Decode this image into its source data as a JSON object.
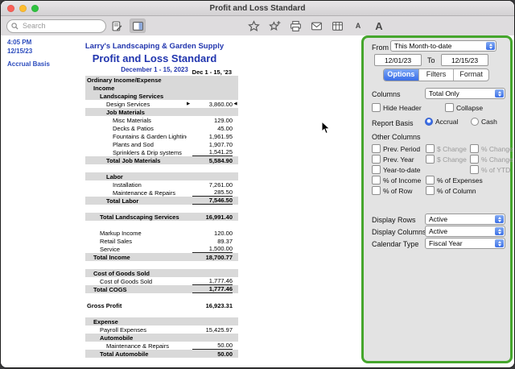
{
  "window": {
    "title": "Profit and Loss Standard"
  },
  "toolbar": {
    "search_placeholder": "Search",
    "font_small_label": "A",
    "font_large_label": "A"
  },
  "meta": {
    "time": "4:05 PM",
    "date": "12/15/23",
    "basis": "Accrual Basis"
  },
  "report": {
    "company": "Larry's Landscaping & Garden Supply",
    "title": "Profit and Loss Standard",
    "period": "December 1 - 15, 2023",
    "column_header": "Dec 1 - 15, '23",
    "rows": [
      {
        "label": "Ordinary Income/Expense",
        "value": "",
        "indent": 0,
        "band": true,
        "bold": true
      },
      {
        "label": "Income",
        "value": "",
        "indent": 1,
        "band": true,
        "bold": true
      },
      {
        "label": "Landscaping Services",
        "value": "",
        "indent": 2,
        "band": true,
        "bold": true
      },
      {
        "label": "Design Services",
        "value": "3,860.00",
        "indent": 3,
        "marker_pre": "▶",
        "marker_post": "◀"
      },
      {
        "label": "Job Materials",
        "value": "",
        "indent": 3,
        "band": true,
        "bold": true
      },
      {
        "label": "Misc Materials",
        "value": "129.00",
        "indent": 4
      },
      {
        "label": "Decks & Patios",
        "value": "45.00",
        "indent": 4
      },
      {
        "label": "Fountains & Garden Lighting",
        "value": "1,961.95",
        "indent": 4
      },
      {
        "label": "Plants and Sod",
        "value": "1,907.70",
        "indent": 4
      },
      {
        "label": "Sprinklers & Drip systems",
        "value": "1,541.25",
        "indent": 4,
        "underline": true
      },
      {
        "label": "Total Job Materials",
        "value": "5,584.90",
        "indent": 3,
        "band": true,
        "bold": true
      },
      {
        "spacer": true
      },
      {
        "label": "Labor",
        "value": "",
        "indent": 3,
        "band": true,
        "bold": true
      },
      {
        "label": "Installation",
        "value": "7,261.00",
        "indent": 4
      },
      {
        "label": "Maintenance & Repairs",
        "value": "285.50",
        "indent": 4,
        "underline": true
      },
      {
        "label": "Total Labor",
        "value": "7,546.50",
        "indent": 3,
        "band": true,
        "bold": true,
        "underline": true
      },
      {
        "spacer": true
      },
      {
        "label": "Total Landscaping Services",
        "value": "16,991.40",
        "indent": 2,
        "band": true,
        "bold": true
      },
      {
        "spacer": true
      },
      {
        "label": "Markup Income",
        "value": "120.00",
        "indent": 2
      },
      {
        "label": "Retail Sales",
        "value": "89.37",
        "indent": 2
      },
      {
        "label": "Service",
        "value": "1,500.00",
        "indent": 2,
        "underline": true
      },
      {
        "label": "Total Income",
        "value": "18,700.77",
        "indent": 1,
        "band": true,
        "bold": true
      },
      {
        "spacer": true
      },
      {
        "label": "Cost of Goods Sold",
        "value": "",
        "indent": 1,
        "band": true,
        "bold": true
      },
      {
        "label": "Cost of Goods Sold",
        "value": "1,777.46",
        "indent": 2,
        "underline": true
      },
      {
        "label": "Total COGS",
        "value": "1,777.46",
        "indent": 1,
        "band": true,
        "bold": true,
        "underline": true
      },
      {
        "spacer": true
      },
      {
        "label": "Gross Profit",
        "value": "16,923.31",
        "indent": 0,
        "bold": true
      },
      {
        "spacer": true
      },
      {
        "label": "Expense",
        "value": "",
        "indent": 1,
        "band": true,
        "bold": true
      },
      {
        "label": "Payroll Expenses",
        "value": "15,425.97",
        "indent": 2
      },
      {
        "label": "Automobile",
        "value": "",
        "indent": 2,
        "band": true,
        "bold": true
      },
      {
        "label": "Maintenance & Repairs",
        "value": "50.00",
        "indent": 3,
        "underline": true
      },
      {
        "label": "Total Automobile",
        "value": "50.00",
        "indent": 2,
        "band": true,
        "bold": true
      }
    ]
  },
  "panel": {
    "from": {
      "label": "From",
      "value": "This Month-to-date"
    },
    "date_range": {
      "from": "12/01/23",
      "to_label": "To",
      "to": "12/15/23"
    },
    "tabs": [
      {
        "label": "Options",
        "selected": true
      },
      {
        "label": "Filters",
        "selected": false
      },
      {
        "label": "Format",
        "selected": false
      }
    ],
    "columns": {
      "label": "Columns",
      "value": "Total Only"
    },
    "checks_top": [
      {
        "label": "Hide Header",
        "checked": false
      },
      {
        "label": "Collapse",
        "checked": false
      }
    ],
    "report_basis": {
      "label": "Report Basis",
      "options": [
        {
          "label": "Accrual",
          "selected": true
        },
        {
          "label": "Cash",
          "selected": false
        }
      ]
    },
    "other_columns_label": "Other Columns",
    "grid": [
      [
        {
          "label": "Prev. Period"
        },
        {
          "label": "$ Change",
          "disabled": true
        },
        {
          "label": "% Change",
          "disabled": true
        }
      ],
      [
        {
          "label": "Prev. Year"
        },
        {
          "label": "$ Change",
          "disabled": true
        },
        {
          "label": "% Change",
          "disabled": true
        }
      ],
      [
        {
          "label": "Year-to-date"
        },
        null,
        {
          "label": "% of YTD",
          "disabled": true
        }
      ],
      [
        {
          "label": "% of Income"
        },
        {
          "label": "% of Expenses"
        },
        null
      ],
      [
        {
          "label": "% of Row"
        },
        {
          "label": "% of Column"
        },
        null
      ]
    ],
    "dropdown_rows": [
      {
        "label": "Display Rows",
        "value": "Active"
      },
      {
        "label": "Display Columns",
        "value": "Active"
      },
      {
        "label": "Calendar Type",
        "value": "Fiscal Year"
      }
    ],
    "accent_green": "#45a62c",
    "accent_blue": "#3a6ee8"
  }
}
